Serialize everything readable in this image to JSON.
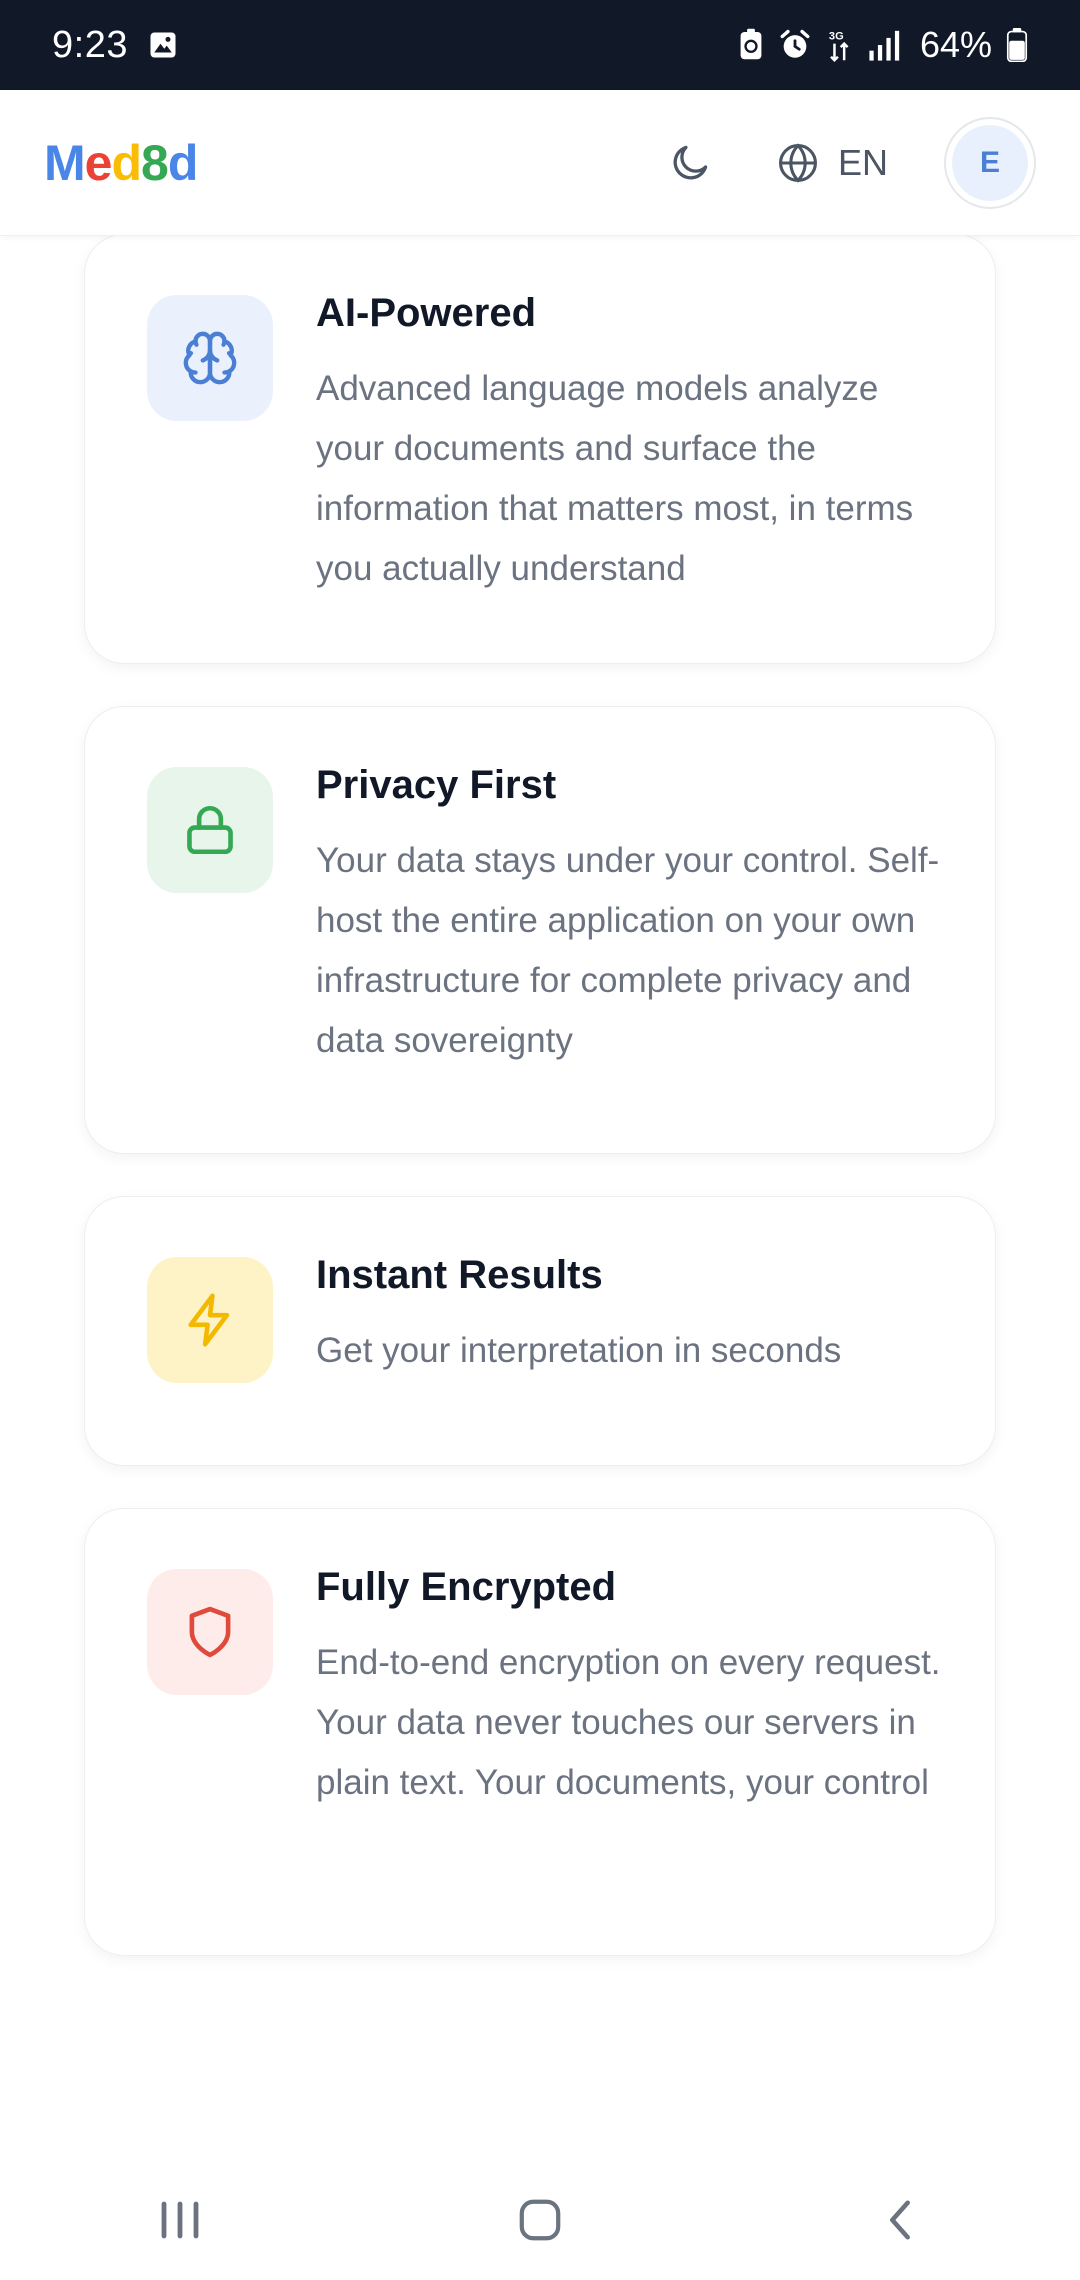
{
  "status_bar": {
    "time": "9:23",
    "battery": "64%"
  },
  "header": {
    "logo_letters": [
      {
        "char": "M",
        "color": "#4a86e8"
      },
      {
        "char": "e",
        "color": "#ea4335"
      },
      {
        "char": "d",
        "color": "#fbbc05"
      },
      {
        "char": "8",
        "color": "#34a853"
      },
      {
        "char": "d",
        "color": "#4a86e8"
      }
    ],
    "language": "EN",
    "avatar_initial": "E"
  },
  "features": [
    {
      "title": "AI-Powered",
      "description": "Advanced language models analyze your documents and surface the information that matters most, in terms you actually understand",
      "icon": "brain-icon",
      "icon_color": "#4a7fd4",
      "icon_bg": "#eaf1fd"
    },
    {
      "title": "Privacy First",
      "description": "Your data stays under your control. Self-host the entire application on your own infrastructure for complete privacy and data sovereignty",
      "icon": "lock-icon",
      "icon_color": "#34a853",
      "icon_bg": "#e8f5ea"
    },
    {
      "title": "Instant Results",
      "description": "Get your interpretation in seconds",
      "icon": "lightning-icon",
      "icon_color": "#f2b900",
      "icon_bg": "#fef3c7"
    },
    {
      "title": "Fully Encrypted",
      "description": "End-to-end encryption on every request. Your data never touches our servers in plain text. Your documents, your control",
      "icon": "shield-icon",
      "icon_color": "#e04a3a",
      "icon_bg": "#fdecea"
    }
  ]
}
